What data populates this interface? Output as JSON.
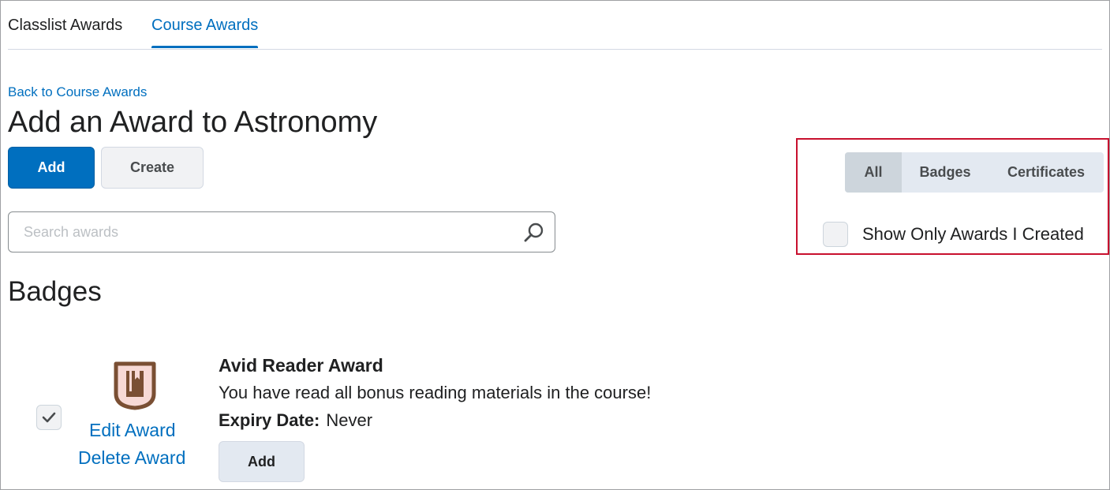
{
  "tabs": [
    {
      "label": "Classlist Awards",
      "active": false
    },
    {
      "label": "Course Awards",
      "active": true
    }
  ],
  "back_link": "Back to Course Awards",
  "page_title": "Add an Award to Astronomy",
  "actions": {
    "add_label": "Add",
    "create_label": "Create"
  },
  "search": {
    "placeholder": "Search awards",
    "value": ""
  },
  "filters": {
    "options": [
      "All",
      "Badges",
      "Certificates"
    ],
    "selected": "All",
    "show_only_mine_label": "Show Only Awards I Created",
    "show_only_mine_checked": false
  },
  "section": {
    "title": "Badges"
  },
  "awards": [
    {
      "name": "Avid Reader Award",
      "description": "You have read all bonus reading materials in the course!",
      "expiry_label": "Expiry Date:",
      "expiry_value": "Never",
      "edit_label": "Edit Award",
      "delete_label": "Delete Award",
      "add_label": "Add",
      "checked": true,
      "icon": "book-badge-icon"
    }
  ],
  "colors": {
    "accent": "#006fbf",
    "highlight_box": "#c8102e",
    "badge_fill": "#f7d9d5",
    "badge_stroke": "#7a4f33"
  }
}
